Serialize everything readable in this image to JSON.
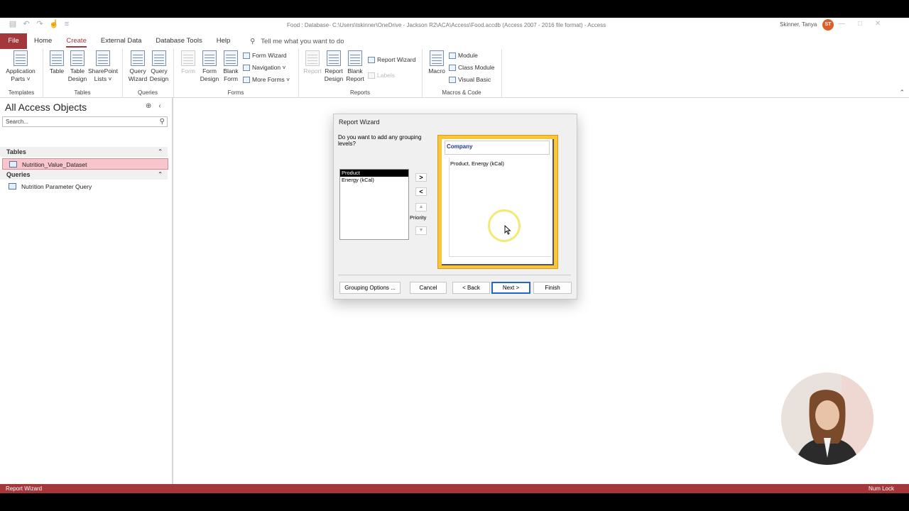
{
  "window": {
    "title": "Food : Database- C:\\Users\\tskinner\\OneDrive - Jackson R2\\ACA\\Access\\Food.accdb (Access 2007 - 2016 file format)  -  Access",
    "user_name": "Skinner, Tanya",
    "user_initials": "ST"
  },
  "ribbon": {
    "tabs": {
      "file": "File",
      "home": "Home",
      "create": "Create",
      "external_data": "External Data",
      "database_tools": "Database Tools",
      "help": "Help"
    },
    "tell_me": "Tell me what you want to do",
    "groups": {
      "templates": {
        "label": "Templates",
        "application_parts": "Application Parts ˅"
      },
      "tables": {
        "label": "Tables",
        "table": "Table",
        "table_design": "Table Design",
        "sharepoint_lists": "SharePoint Lists ˅"
      },
      "queries": {
        "label": "Queries",
        "query_wizard": "Query Wizard",
        "query_design": "Query Design"
      },
      "forms": {
        "label": "Forms",
        "form": "Form",
        "form_design": "Form Design",
        "blank_form": "Blank Form",
        "form_wizard": "Form Wizard",
        "navigation": "Navigation ˅",
        "more_forms": "More Forms ˅"
      },
      "reports": {
        "label": "Reports",
        "report": "Report",
        "report_design": "Report Design",
        "blank_report": "Blank Report",
        "report_wizard": "Report Wizard",
        "labels": "Labels"
      },
      "macros": {
        "label": "Macros & Code",
        "macro": "Macro",
        "module": "Module",
        "class_module": "Class Module",
        "visual_basic": "Visual Basic"
      }
    }
  },
  "nav": {
    "title": "All Access Objects",
    "search_placeholder": "Search...",
    "sections": [
      {
        "label": "Tables",
        "items": [
          "Nutrition_Value_Dataset"
        ]
      },
      {
        "label": "Queries",
        "items": [
          "Nutrition Parameter Query"
        ]
      }
    ],
    "selected_item": "Nutrition_Value_Dataset"
  },
  "dialog": {
    "title": "Report Wizard",
    "question": "Do you want to add any grouping levels?",
    "fields": [
      "Product",
      "Energy (kCal)"
    ],
    "selected_field": "Product",
    "add_button": ">",
    "remove_button": "<",
    "priority_label": "Priority",
    "preview_header": "Company",
    "preview_detail": "Product, Energy (kCal)",
    "buttons": {
      "grouping_options": "Grouping Options ...",
      "cancel": "Cancel",
      "back": "< Back",
      "next": "Next >",
      "finish": "Finish"
    }
  },
  "status": {
    "left": "Report Wizard",
    "right": "Num Lock"
  }
}
